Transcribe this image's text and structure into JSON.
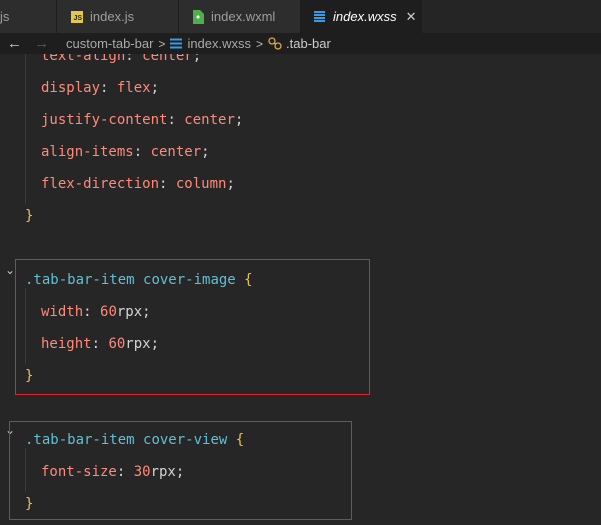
{
  "tabs": [
    {
      "label": "js",
      "icon": "js-file-icon",
      "active": false
    },
    {
      "label": "index.js",
      "icon": "js-file-icon",
      "active": false
    },
    {
      "label": "index.wxml",
      "icon": "wxml-file-icon",
      "active": false
    },
    {
      "label": "index.wxss",
      "icon": "css-file-icon",
      "active": true
    }
  ],
  "js_badge": "JS",
  "close_glyph": "✕",
  "breadcrumb": {
    "back": "←",
    "forward": "→",
    "folder": "custom-tab-bar",
    "sep": ">",
    "file": "index.wxss",
    "symbol": ".tab-bar",
    "file_icon": "css-file-icon",
    "symbol_icon": "selector-symbol-icon"
  },
  "code": {
    "partial": {
      "prop": "text-align",
      "value": "center"
    },
    "block1": [
      {
        "prop": "display",
        "value": "flex"
      },
      {
        "prop": "justify-content",
        "value": "center"
      },
      {
        "prop": "align-items",
        "value": "center"
      },
      {
        "prop": "flex-direction",
        "value": "column"
      }
    ],
    "rule2": {
      "selector_class": ".tab-bar-item",
      "selector_tag": "cover-image",
      "decls": [
        {
          "prop": "width",
          "num": "60",
          "unit": "rpx"
        },
        {
          "prop": "height",
          "num": "60",
          "unit": "rpx"
        }
      ]
    },
    "rule3": {
      "selector_class": ".tab-bar-item",
      "selector_tag": "cover-view",
      "decls": [
        {
          "prop": "font-size",
          "num": "30",
          "unit": "rpx"
        }
      ]
    },
    "open_brace": "{",
    "close_brace": "}",
    "colon": ": ",
    "semicolon": ";"
  },
  "colors": {
    "highlight_box": "#d8282d",
    "css_icon": "#3a9be0",
    "wxml_icon": "#4db04a",
    "js_icon": "#e4c74a"
  }
}
